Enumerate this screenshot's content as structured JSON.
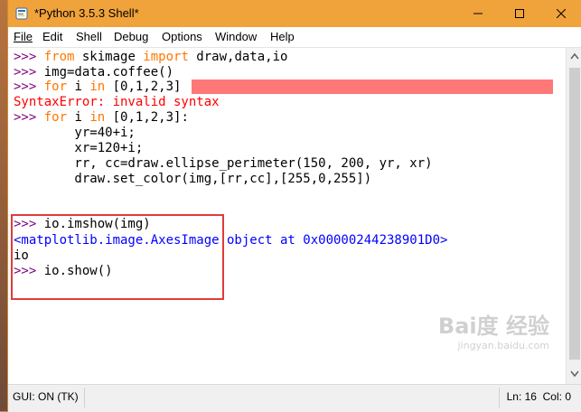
{
  "window": {
    "title": "*Python 3.5.3 Shell*",
    "accent": "#f0a23b"
  },
  "menu": [
    {
      "label": "File"
    },
    {
      "label": "Edit"
    },
    {
      "label": "Shell"
    },
    {
      "label": "Debug"
    },
    {
      "label": "Options"
    },
    {
      "label": "Window"
    },
    {
      "label": "Help"
    }
  ],
  "shell": {
    "prompt": ">>> ",
    "l1": {
      "a": "from",
      "b": " skimage ",
      "c": "import",
      "d": " draw,data,io"
    },
    "l2": "img=data.coffee()",
    "l3": {
      "a": "for",
      "b": " i ",
      "c": "in",
      "d": " [0,1,2,3]"
    },
    "l4": "SyntaxError: invalid syntax",
    "l5": {
      "a": "for",
      "b": " i ",
      "c": "in",
      "d": " [0,1,2,3]:"
    },
    "l6": "        yr=40+i;",
    "l7": "        xr=120+i;",
    "l8": "        rr, cc=draw.ellipse_perimeter(150, 200, yr, xr)",
    "l9": "        draw.set_color(img,[rr,cc],[255,0,255])",
    "l10": "io.imshow(img)",
    "l11": "<matplotlib.image.AxesImage object at 0x00000244238901D0>",
    "l12": "io",
    "l13": "io.show()"
  },
  "status": {
    "left": "GUI: ON (TK)",
    "ln": "Ln: 16",
    "col": "Col: 0"
  },
  "watermark": {
    "main": "Bai度 经验",
    "sub": "jingyan.baidu.com"
  }
}
